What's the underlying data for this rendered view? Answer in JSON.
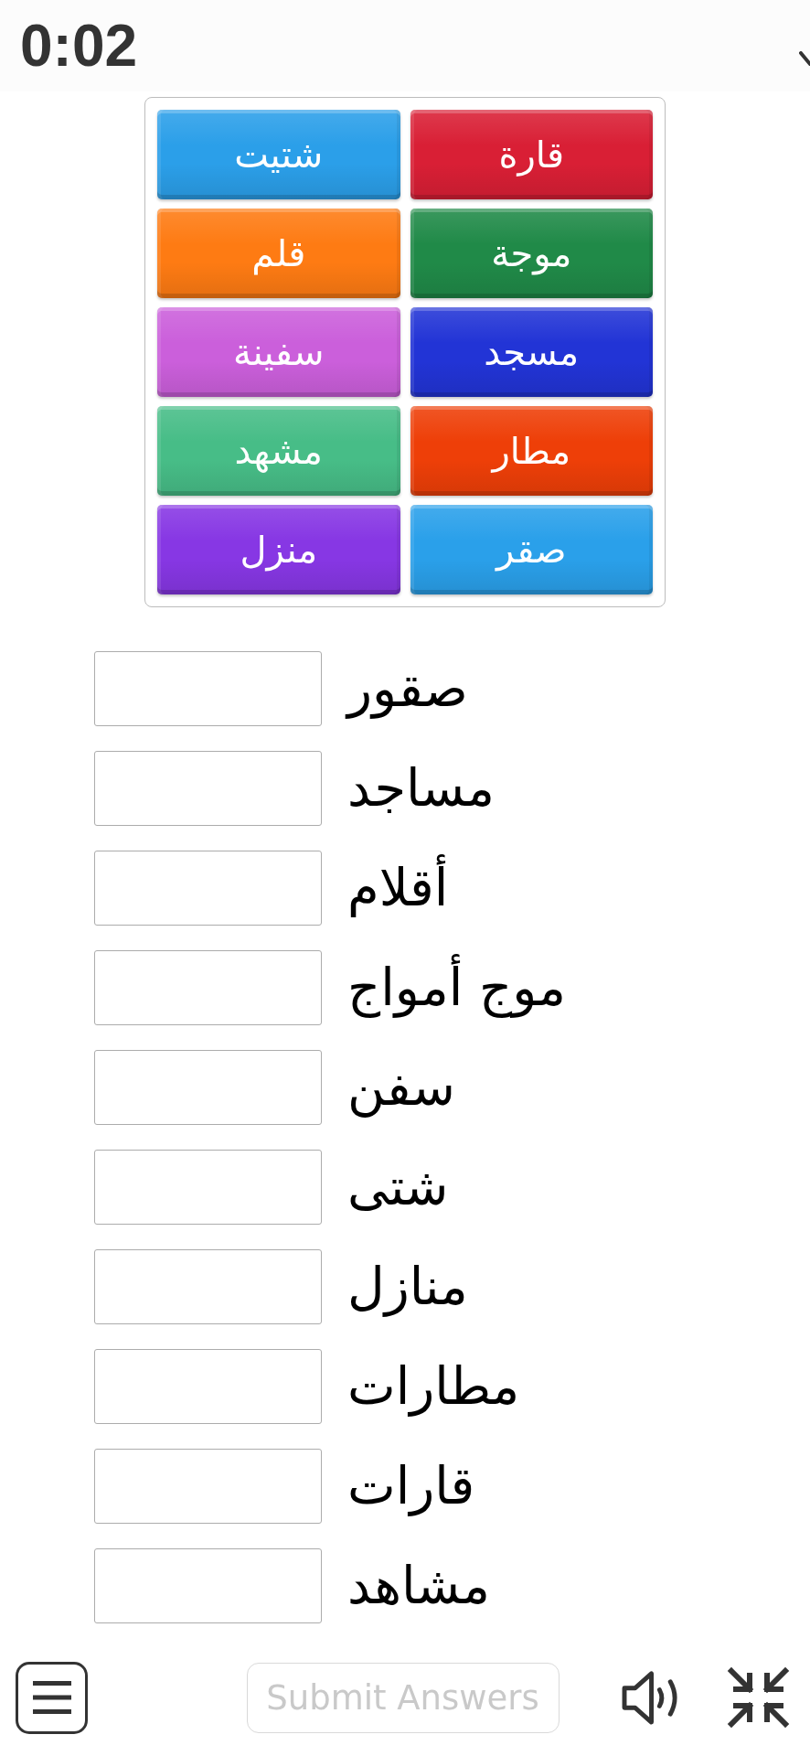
{
  "timer": "0:02",
  "tiles": [
    {
      "label": "قارة",
      "color": "#d91f35"
    },
    {
      "label": "شتيت",
      "color": "#2b9fe9"
    },
    {
      "label": "موجة",
      "color": "#208a48"
    },
    {
      "label": "قلم",
      "color": "#fe7b13"
    },
    {
      "label": "مسجد",
      "color": "#2234d6"
    },
    {
      "label": "سفينة",
      "color": "#cb5fdb"
    },
    {
      "label": "مطار",
      "color": "#ee3f08"
    },
    {
      "label": "مشهد",
      "color": "#47bd87"
    },
    {
      "label": "صقر",
      "color": "#2aa0ea"
    },
    {
      "label": "منزل",
      "color": "#8737e4"
    }
  ],
  "rows": [
    {
      "label": "صقور"
    },
    {
      "label": "مساجد"
    },
    {
      "label": "أقلام"
    },
    {
      "label": "موج أمواج"
    },
    {
      "label": "سفن"
    },
    {
      "label": "شتى"
    },
    {
      "label": "منازل"
    },
    {
      "label": "مطارات"
    },
    {
      "label": "قارات"
    },
    {
      "label": "مشاهد"
    }
  ],
  "toolbar": {
    "submit_button": {
      "label": "Submit Answers",
      "disabled": true
    }
  }
}
